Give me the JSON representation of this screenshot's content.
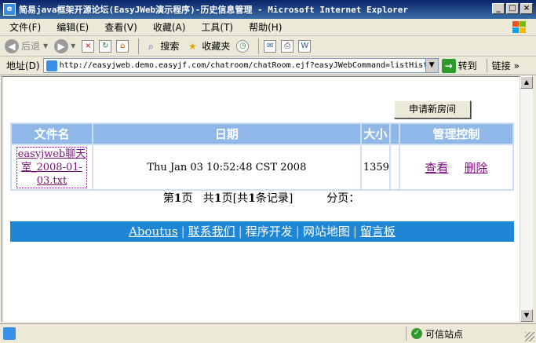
{
  "window": {
    "title": "简易java框架开源论坛(EasyJWeb演示程序)-历史信息管理 - Microsoft Internet Explorer",
    "min": "_",
    "max": "□",
    "close": "×"
  },
  "menu": {
    "items": [
      "文件(F)",
      "编辑(E)",
      "查看(V)",
      "收藏(A)",
      "工具(T)",
      "帮助(H)"
    ]
  },
  "toolbar": {
    "back": "后退",
    "search": "搜索",
    "favorites": "收藏夹"
  },
  "address": {
    "label": "地址(D)",
    "url": "http://easyjweb.demo.easyjf.com/chatroom/chatRoom.ejf?easyJWebCommand=listHist",
    "go": "转到",
    "links": "链接"
  },
  "page": {
    "new_room_button": "申请新房间",
    "table": {
      "headers": [
        "文件名",
        "日期",
        "大小",
        "",
        "管理控制"
      ],
      "rows": [
        {
          "file": "easyjweb聊天室_2008-01-03.txt",
          "date": "Thu Jan 03 10:52:48 CST 2008",
          "size": "1359",
          "view": "查看",
          "delete": "删除"
        }
      ]
    },
    "pager": {
      "prefix_page": "第",
      "current": "1",
      "suffix_page": "页",
      "total_prefix": "共",
      "total_pages": "1",
      "total_suffix": "页",
      "records_prefix": "[共",
      "records": "1",
      "records_suffix": "条记录]",
      "paging_label": "分页："
    },
    "footer_links": [
      "Aboutus",
      "联系我们",
      "程序开发",
      "网站地图",
      "留言板"
    ]
  },
  "status": {
    "zone": "可信站点"
  }
}
